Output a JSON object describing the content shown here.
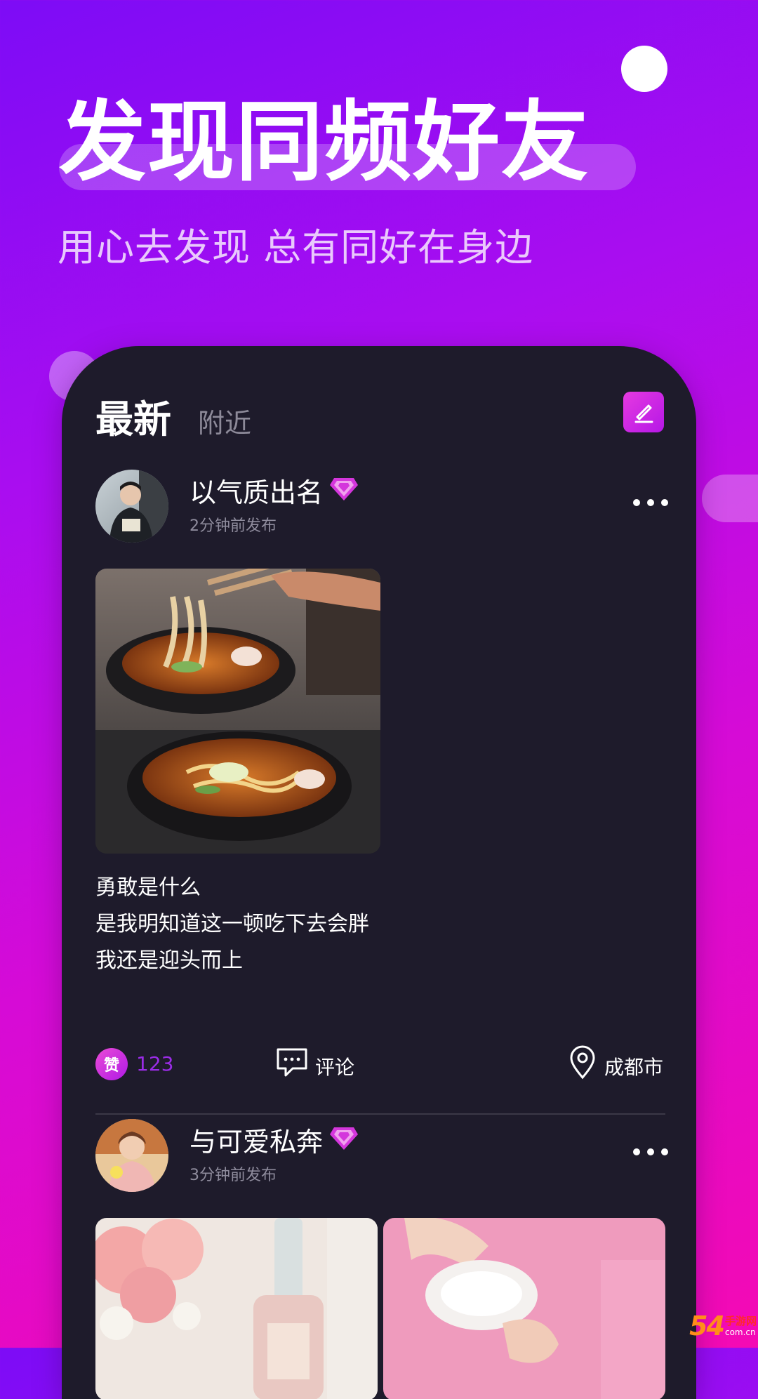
{
  "banner": {
    "headline": "发现同频好友",
    "subline": "用心去发现 总有同好在身边"
  },
  "tabs": [
    {
      "label": "最新",
      "active": true
    },
    {
      "label": "附近",
      "active": false
    }
  ],
  "posts": [
    {
      "username": "以气质出名",
      "time": "2分钟前发布",
      "text_lines": [
        "勇敢是什么",
        "是我明知道这一顿吃下去会胖",
        "我还是迎头而上"
      ],
      "like_icon_text": "赞",
      "likes": "123",
      "comment_label": "评论",
      "location": "成都市"
    },
    {
      "username": "与可爱私奔",
      "time": "3分钟前发布"
    }
  ],
  "watermark": {
    "number": "54",
    "name": "手游网",
    "url": "com.cn"
  },
  "colors": {
    "accent": "#b517e7",
    "card_bg": "#1e1b2b",
    "like_count": "#9a2ce6"
  },
  "icons": [
    "edit-icon",
    "diamond-badge-icon",
    "more-icon",
    "comment-icon",
    "location-pin-icon"
  ]
}
